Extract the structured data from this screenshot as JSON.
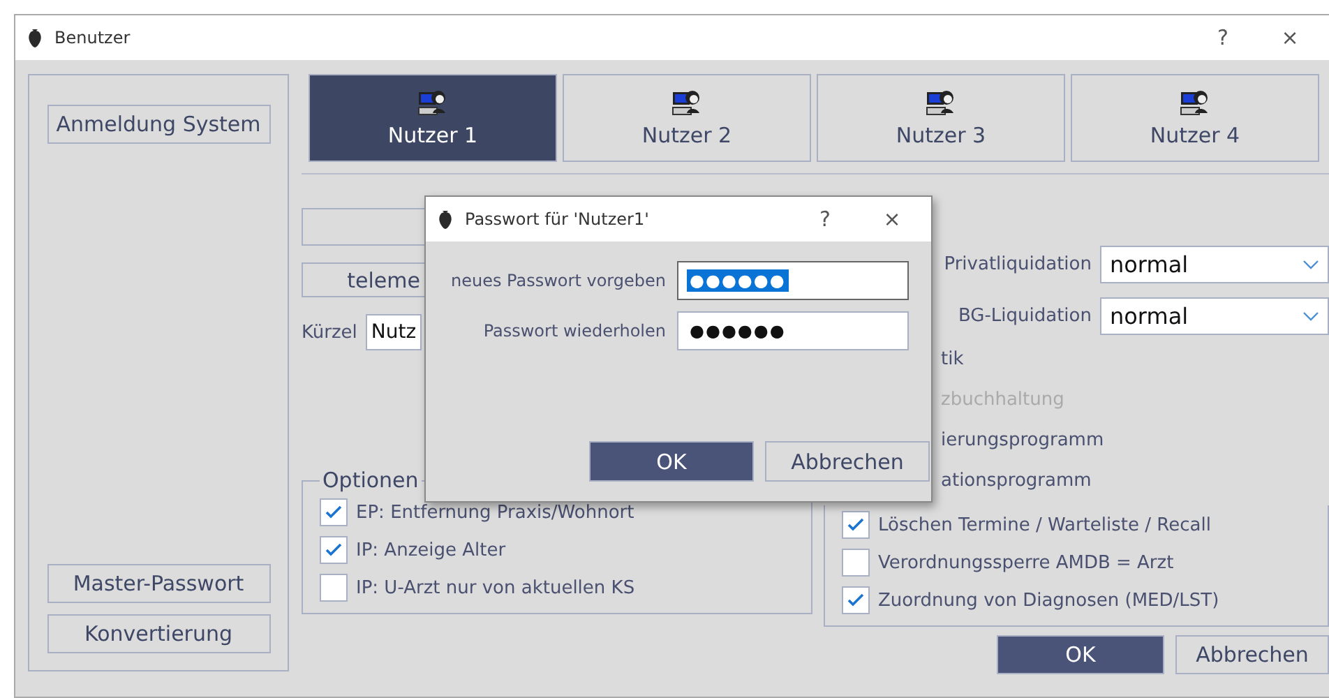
{
  "window": {
    "title": "Benutzer",
    "buttons": [
      "?",
      "×"
    ]
  },
  "sidebar": {
    "top_button": "Anmeldung System",
    "bottom_buttons": [
      "Master-Passwort",
      "Konvertierung"
    ]
  },
  "tabs": [
    {
      "label": "Nutzer 1",
      "selected": true
    },
    {
      "label": "Nutzer 2",
      "selected": false
    },
    {
      "label": "Nutzer 3",
      "selected": false
    },
    {
      "label": "Nutzer 4",
      "selected": false
    }
  ],
  "left": {
    "upper_button": "teleme",
    "kuerzel_label": "Kürzel",
    "kuerzel_value": "Nutz"
  },
  "options": {
    "title": "Optionen",
    "items": [
      {
        "label": "EP: Entfernung Praxis/Wohnort",
        "checked": true
      },
      {
        "label": "IP: Anzeige Alter",
        "checked": true
      },
      {
        "label": "IP: U-Arzt nur von aktuellen KS",
        "checked": false
      }
    ]
  },
  "right": {
    "selects": [
      {
        "label": "Privatliquidation",
        "value": "normal"
      },
      {
        "label": "BG-Liquidation",
        "value": "normal"
      }
    ],
    "items": [
      {
        "kind": "hidden",
        "label": "tik",
        "disabled": false
      },
      {
        "kind": "hidden",
        "label": "zbuchhaltung",
        "disabled": true
      },
      {
        "kind": "hidden",
        "label": "ierungsprogramm",
        "disabled": false
      },
      {
        "kind": "hidden",
        "label": "ationsprogramm",
        "disabled": false
      },
      {
        "kind": "checkbox",
        "label": "Löschen Termine / Warteliste / Recall",
        "checked": true
      },
      {
        "kind": "checkbox",
        "label": "Verordnungssperre AMDB = Arzt",
        "checked": false
      },
      {
        "kind": "checkbox",
        "label": "Zuordnung von Diagnosen (MED/LST)",
        "checked": true
      }
    ]
  },
  "footer_buttons": [
    {
      "label": "OK",
      "primary": true
    },
    {
      "label": "Abbrechen",
      "primary": false
    }
  ],
  "dialog": {
    "title": "Passwort für 'Nutzer1'",
    "buttons": [
      "?",
      "×"
    ],
    "fields": [
      {
        "label": "neues Passwort vorgeben",
        "value": "●●●●●●",
        "selected": true
      },
      {
        "label": "Passwort wiederholen",
        "value": "●●●●●●",
        "selected": false
      }
    ],
    "actions": [
      {
        "label": "OK",
        "primary": true
      },
      {
        "label": "Abbrechen",
        "primary": false
      }
    ]
  }
}
